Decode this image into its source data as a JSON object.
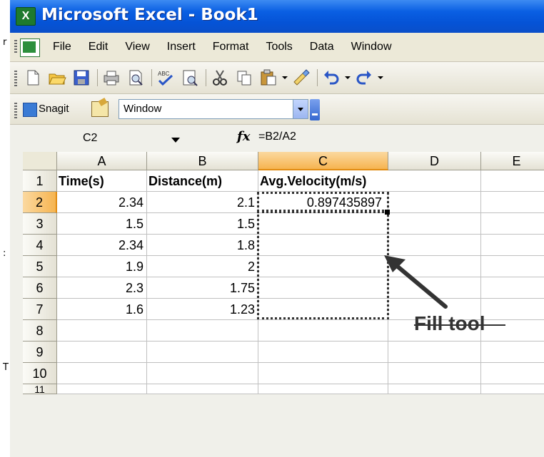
{
  "window": {
    "title": "Microsoft Excel - Book1"
  },
  "menu": {
    "items": [
      "File",
      "Edit",
      "View",
      "Insert",
      "Format",
      "Tools",
      "Data",
      "Window"
    ]
  },
  "snagit_toolbar": {
    "label": "Snagit",
    "window_select": "Window"
  },
  "formula_bar": {
    "name_box": "C2",
    "fx": "fx",
    "formula": "=B2/A2"
  },
  "sheet": {
    "columns": [
      "A",
      "B",
      "C",
      "D",
      "E"
    ],
    "rows": [
      "1",
      "2",
      "3",
      "4",
      "5",
      "6",
      "7",
      "8",
      "9",
      "10",
      "11"
    ],
    "cells": {
      "A1": "Time(s)",
      "B1": "Distance(m)",
      "C1": "Avg.Velocity(m/s)",
      "A2": "2.34",
      "B2": "2.1",
      "C2": "0.897435897",
      "A3": "1.5",
      "B3": "1.5",
      "A4": "2.34",
      "B4": "1.8",
      "A5": "1.9",
      "B5": "2",
      "A6": "2.3",
      "B6": "1.75",
      "A7": "1.6",
      "B7": "1.23"
    }
  },
  "annotation": {
    "text": "Fill tool"
  },
  "colors": {
    "title_bar": "#0a5fe3",
    "active_header": "#f6b450"
  }
}
